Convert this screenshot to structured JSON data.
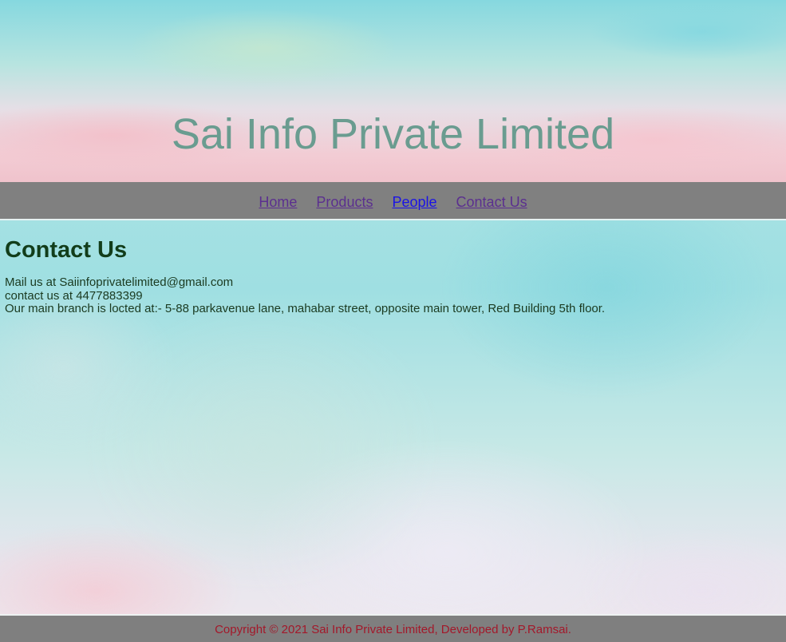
{
  "header": {
    "title": "Sai Info Private Limited"
  },
  "nav": {
    "items": [
      {
        "label": "Home"
      },
      {
        "label": "Products"
      },
      {
        "label": "People"
      },
      {
        "label": "Contact Us"
      }
    ]
  },
  "main": {
    "heading": "Contact Us",
    "lines": [
      "Mail us at Saiinfoprivatelimited@gmail.com",
      "contact us at 4477883399",
      "Our main branch is locted at:- 5-88 parkavenue lane, mahabar street, opposite main tower, Red Building 5th floor."
    ]
  },
  "footer": {
    "text": "Copyright © 2021 Sai Info Private Limited, Developed by P.Ramsai."
  },
  "colors": {
    "title": "#6a9c90",
    "nav_bar": "#808080",
    "link_visited": "#5b2f8f",
    "link_unvisited": "#1a13e6",
    "heading": "#123d1a",
    "footer_text": "#a3182a"
  }
}
